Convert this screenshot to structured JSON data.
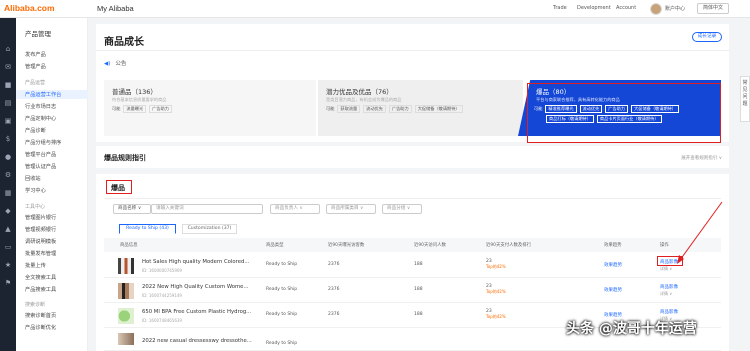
{
  "topbar": {
    "logo": "Alibaba",
    "logo_suffix": ".com",
    "title": "My Alibaba",
    "nav": [
      "Trade",
      "Development",
      "Account"
    ],
    "user": "账户中心",
    "lang": "简体中文"
  },
  "sidebar": {
    "head": "产品管理",
    "items": [
      {
        "label": "发布产品",
        "type": "item"
      },
      {
        "label": "管理产品",
        "type": "item"
      },
      {
        "label": "产品运营",
        "type": "group"
      },
      {
        "label": "产品运营工作台",
        "type": "active"
      },
      {
        "label": "行业市场日志",
        "type": "item"
      },
      {
        "label": "产品定制中心",
        "type": "item"
      },
      {
        "label": "产品诊断",
        "type": "item"
      },
      {
        "label": "产品分组与排序",
        "type": "item"
      },
      {
        "label": "管理平台产品",
        "type": "item"
      },
      {
        "label": "管理认证产品",
        "type": "item"
      },
      {
        "label": "回收站",
        "type": "item"
      },
      {
        "label": "学习中心",
        "type": "item"
      },
      {
        "label": "工具中心",
        "type": "group"
      },
      {
        "label": "管理图片银行",
        "type": "item"
      },
      {
        "label": "管理视频银行",
        "type": "item"
      },
      {
        "label": "调研说明模板",
        "type": "item"
      },
      {
        "label": "批量发布管理",
        "type": "item"
      },
      {
        "label": "批量上传",
        "type": "item"
      },
      {
        "label": "全文搜索工具",
        "type": "item"
      },
      {
        "label": "产品搜索工具",
        "type": "item"
      },
      {
        "label": "搜索诊断",
        "type": "group"
      },
      {
        "label": "搜索诊断首页",
        "type": "item"
      },
      {
        "label": "产品诊断优化",
        "type": "item"
      }
    ]
  },
  "main": {
    "title": "商品成长",
    "record_btn": "成长记录",
    "notice": "公告",
    "tiers": [
      {
        "title": "普通品（136）",
        "desc": "符合基本信息质量要求的商品",
        "tags": [
          "可能",
          "流量曝光",
          "广告助力"
        ]
      },
      {
        "title": "潜力优品及优品（76）",
        "desc": "是类目潜力商品，有机会成为爆品的商品",
        "tags": [
          "可能",
          "获取流量",
          "流动优先",
          "广告助力",
          "大促储备（敬请期待）"
        ]
      },
      {
        "title": "爆品（80）",
        "desc": "平台与商家联合推荐，具有高转化能力的商品",
        "tags": [
          "可能",
          "精准推荐曝光",
          "流动优先",
          "广告助力",
          "大促储备（敬请期待）",
          "商品打标（敬请期待）",
          "商品卡片页面行业（敬请期待）"
        ]
      }
    ],
    "rules_title": "爆品规则指引",
    "rules_link": "展开查看规则指引 ∨",
    "section_title": "爆品",
    "filters": {
      "product_type": "商品名称",
      "search_placeholder": "请输入关键词",
      "owner": "商品负责人",
      "category": "商品所属类目",
      "group": "商品分组"
    },
    "subtabs": [
      "Ready to Ship (43)",
      "Customization (37)"
    ],
    "columns": [
      "商品信息",
      "商品类型",
      "近90天曝光访客数",
      "近90天访问人数",
      "近90天支付人数及排行",
      "效果趋势",
      "操作"
    ],
    "rows": [
      {
        "name": "Hot Sales High quality Modern Colored...",
        "id": "ID: 1600000745909",
        "type": "Ready to Ship",
        "exposure": "2376",
        "visitors": "188",
        "pay": "23",
        "rank": "Top的42%",
        "trend": "效果趋势",
        "op": "商品影像",
        "more": "详情 ∨"
      },
      {
        "name": "2022 New High Quality Custom Wome...",
        "id": "ID: 1600744259149",
        "type": "Ready to Ship",
        "exposure": "2376",
        "visitors": "188",
        "pay": "23",
        "rank": "Top的42%",
        "trend": "效果趋势",
        "op": "商品影像",
        "more": "详情 ∨"
      },
      {
        "name": "650 Ml BPA Free Custom Plastic Hydrog...",
        "id": "ID: 1600748465639",
        "type": "Ready to Ship",
        "exposure": "2376",
        "visitors": "188",
        "pay": "23",
        "rank": "Top的42%",
        "trend": "效果趋势",
        "op": "商品影像",
        "more": "详情 ∨"
      },
      {
        "name": "2022 new casual dressesswy dressothe...",
        "id": "",
        "type": "Ready to Ship",
        "exposure": "",
        "visitors": "",
        "pay": "",
        "rank": "",
        "trend": "",
        "op": "",
        "more": ""
      }
    ]
  },
  "help": "常见问题",
  "watermark": "头条 @波哥十年运营",
  "colors": {
    "brand": "#ff6a00",
    "accent": "#1a66ff",
    "hot": "#1547d6",
    "highlight": "#e02020"
  }
}
